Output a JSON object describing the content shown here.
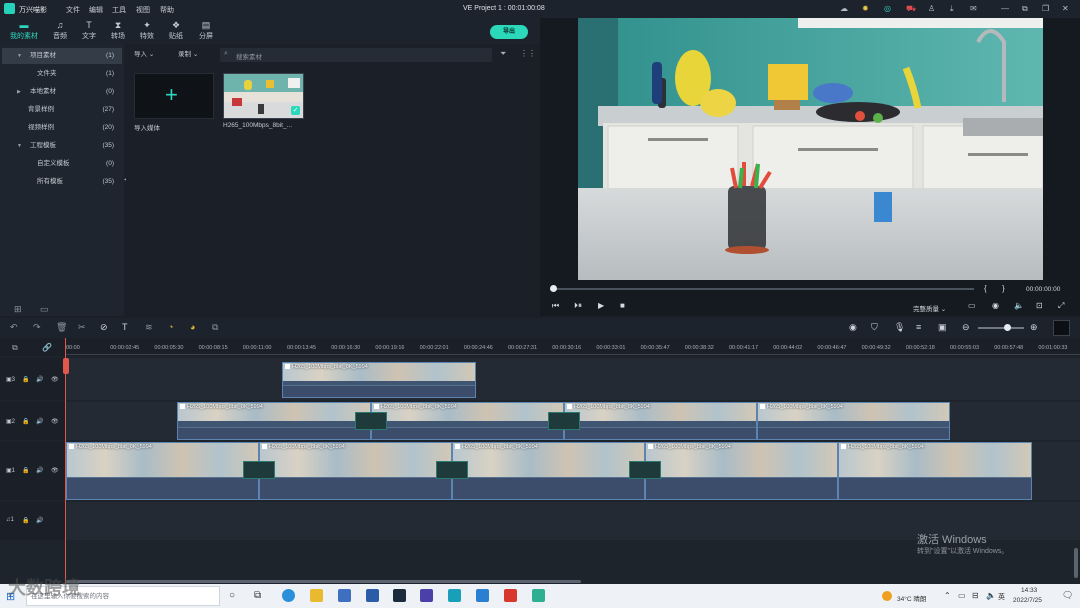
{
  "titlebar": {
    "app_name": "万兴喵影",
    "menus": [
      "文件",
      "编辑",
      "工具",
      "视图",
      "帮助"
    ],
    "project_title": "VE Project 1 : 00:01:00:08"
  },
  "tabs": [
    {
      "label": "我的素材",
      "icon": "folder-icon",
      "active": true
    },
    {
      "label": "音频",
      "icon": "music-icon"
    },
    {
      "label": "文字",
      "icon": "text-icon"
    },
    {
      "label": "转场",
      "icon": "transition-icon"
    },
    {
      "label": "特效",
      "icon": "effects-icon"
    },
    {
      "label": "贴纸",
      "icon": "sticker-icon"
    },
    {
      "label": "分屏",
      "icon": "splitscreen-icon"
    }
  ],
  "export_label": "导出",
  "sidebar": {
    "items": [
      {
        "label": "项目素材",
        "count": "(1)",
        "indent": 0,
        "expanded": true,
        "selected": true
      },
      {
        "label": "文件夹",
        "count": "(1)",
        "indent": 1
      },
      {
        "label": "本地素材",
        "count": "(0)",
        "indent": 0,
        "collapsed": true
      },
      {
        "label": "背景样例",
        "count": "(27)",
        "indent": 0
      },
      {
        "label": "视频样例",
        "count": "(20)",
        "indent": 0
      },
      {
        "label": "工程模板",
        "count": "(35)",
        "indent": 0,
        "expanded": true
      },
      {
        "label": "自定义模板",
        "count": "(0)",
        "indent": 1
      },
      {
        "label": "所有模板",
        "count": "(35)",
        "indent": 1
      }
    ]
  },
  "media_bar": {
    "import_label": "导入",
    "record_label": "录制",
    "search_placeholder": "搜索素材"
  },
  "media_items": [
    {
      "label": "导入媒体"
    },
    {
      "label": "H265_100Mbps_8bit_..."
    }
  ],
  "preview": {
    "time": "00:00:00:00",
    "quality": "完整质量",
    "bracket_left": "{",
    "bracket_right": "}"
  },
  "ruler": {
    "ticks": [
      "00:00",
      "00:00:02:45",
      "00:00:05:30",
      "00:00:08:15",
      "00:00:11:00",
      "00:00:13:45",
      "00:00:16:30",
      "00:00:19:16",
      "00:00:22:01",
      "00:00:24:46",
      "00:00:27:31",
      "00:00:30:16",
      "00:00:33:01",
      "00:00:35:47",
      "00:00:38:32",
      "00:00:41:17",
      "00:00:44:02",
      "00:00:46:47",
      "00:00:49:32",
      "00:00:52:18",
      "00:00:55:03",
      "00:00:57:48",
      "00:01:00:33"
    ]
  },
  "tracks": [
    {
      "label": "3",
      "clips": [
        {
          "title": "H265_100Mbps_8bit_8K_5994"
        }
      ]
    },
    {
      "label": "2",
      "clips": [
        {
          "title": "H265_100Mbps_8bit_8K_5994"
        },
        {
          "title": "H265_100Mbps_8bit_8K_5994"
        },
        {
          "title": "H265_100Mbps_8bit_8K_5994"
        },
        {
          "title": "H265_100Mbps_8bit_8K_5994"
        }
      ]
    },
    {
      "label": "1",
      "clips": [
        {
          "title": "H265_100Mbps_8bit_8K_5994"
        },
        {
          "title": "H265_100Mbps_8bit_8K_5994"
        },
        {
          "title": "H265_100Mbps_8bit_8K_5994"
        },
        {
          "title": "H265_100Mbps_8bit_8K_5994"
        },
        {
          "title": "H265_100Mbps_8bit_8K_5994"
        }
      ]
    },
    {
      "label": "1",
      "type": "audio"
    }
  ],
  "activation": {
    "title": "激活 Windows",
    "subtitle": "转到\"设置\"以激活 Windows。"
  },
  "taskbar": {
    "search_text": "在这里输入你要搜索的内容",
    "weather": "34°C 晴朗",
    "ime": "英",
    "time": "14:33",
    "date": "2022/7/25"
  },
  "logo_watermark": "大数跨境",
  "colors": {
    "accent": "#2bd8b9",
    "playhead": "#e2574c",
    "clip_border": "#5b84b0"
  }
}
